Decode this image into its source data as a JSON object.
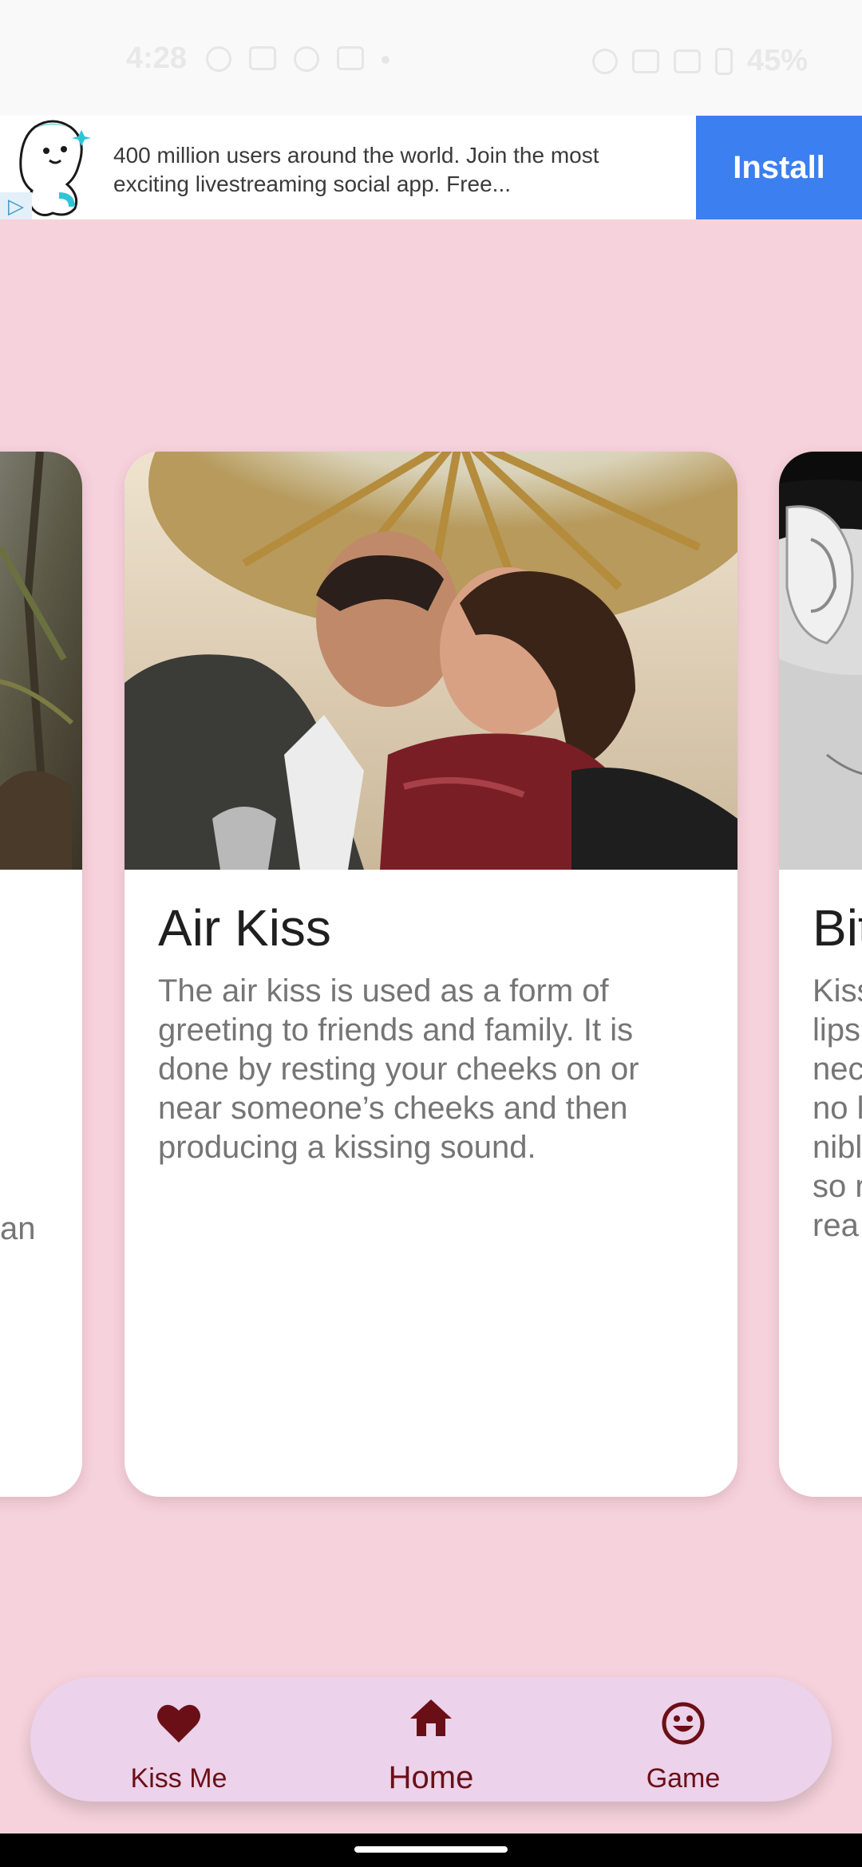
{
  "status_bar": {
    "time": "4:28",
    "battery_percent": "45%",
    "icons_left": [
      "person-icon",
      "message-icon",
      "call-icon",
      "youtube-icon",
      "dot-icon"
    ],
    "icons_right": [
      "dnd-icon",
      "signal-h-icon",
      "signal-icon",
      "battery-icon"
    ]
  },
  "ad": {
    "text": "400 million users around the world. Join the most exciting livestreaming social app. Free...",
    "install_label": "Install",
    "adchoices_glyph": "▷",
    "colors": {
      "install_bg": "#3b7ff0"
    }
  },
  "cards": {
    "left": {
      "desc_fragment": "an"
    },
    "center": {
      "title": "Air Kiss",
      "description": "The air kiss is used as a form of greeting to friends and family. It is done by resting your cheeks on or near someone’s cheeks and then producing a kissing sound."
    },
    "right": {
      "title": "Bit",
      "desc_lines": [
        "Kiss",
        "lips",
        "nec",
        "no l",
        "nibl",
        "so r",
        "rea"
      ]
    }
  },
  "bottom_nav": {
    "items": [
      {
        "label": "Kiss Me",
        "icon": "heart-icon"
      },
      {
        "label": "Home",
        "icon": "home-icon"
      },
      {
        "label": "Game",
        "icon": "smiley-icon"
      }
    ],
    "selected": "Home",
    "colors": {
      "bar_bg": "#ecd2ea",
      "icon": "#6b0f17"
    }
  },
  "colors": {
    "background": "#f6d2dc",
    "card": "#ffffff",
    "title_text": "#1f1f1f",
    "desc_text": "#757575"
  }
}
